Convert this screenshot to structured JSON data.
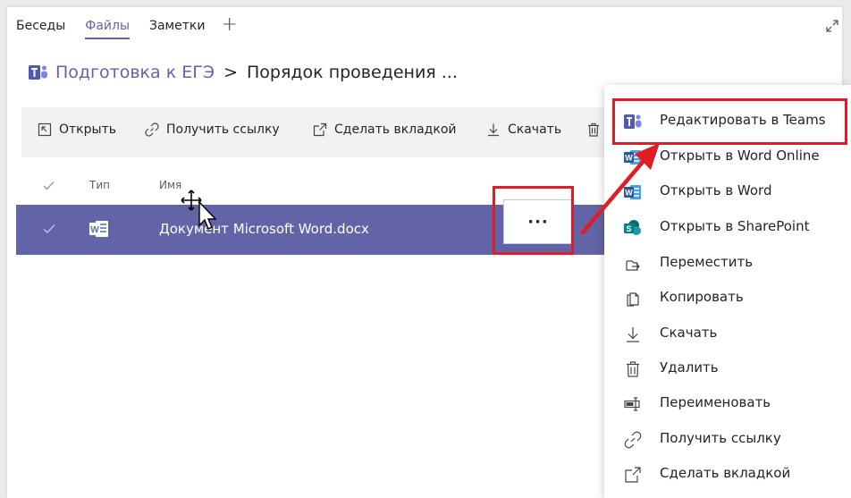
{
  "tabs": [
    {
      "label": "Беседы",
      "active": false
    },
    {
      "label": "Файлы",
      "active": true
    },
    {
      "label": "Заметки",
      "active": false
    }
  ],
  "tab_add": "+",
  "breadcrumb": {
    "root": "Подготовка к ЕГЭ",
    "separator": ">",
    "current": "Порядок проведения ..."
  },
  "toolbar": {
    "open": "Открыть",
    "get_link": "Получить ссылку",
    "make_tab": "Сделать вкладкой",
    "download": "Скачать"
  },
  "table": {
    "col_type": "Тип",
    "col_name": "Имя",
    "rows": [
      {
        "name": "Документ Microsoft Word.docx",
        "type_icon": "word-icon",
        "selected": true
      }
    ]
  },
  "more_button": "···",
  "menu": {
    "items": [
      {
        "label": "Редактировать в Teams",
        "icon": "teams-icon"
      },
      {
        "label": "Открыть в Word Online",
        "icon": "word-icon"
      },
      {
        "label": "Открыть в Word",
        "icon": "word-icon"
      },
      {
        "label": "Открыть в SharePoint",
        "icon": "sharepoint-icon"
      },
      {
        "label": "Переместить",
        "icon": "move-icon"
      },
      {
        "label": "Копировать",
        "icon": "copy-icon"
      },
      {
        "label": "Скачать",
        "icon": "download-icon"
      },
      {
        "label": "Удалить",
        "icon": "trash-icon"
      },
      {
        "label": "Переименовать",
        "icon": "rename-icon"
      },
      {
        "label": "Получить ссылку",
        "icon": "link-icon"
      },
      {
        "label": "Сделать вкладкой",
        "icon": "tab-icon"
      }
    ]
  },
  "colors": {
    "accent": "#6264a7",
    "highlight": "#e01d24",
    "word": "#2b579a",
    "sharepoint": "#038387"
  }
}
